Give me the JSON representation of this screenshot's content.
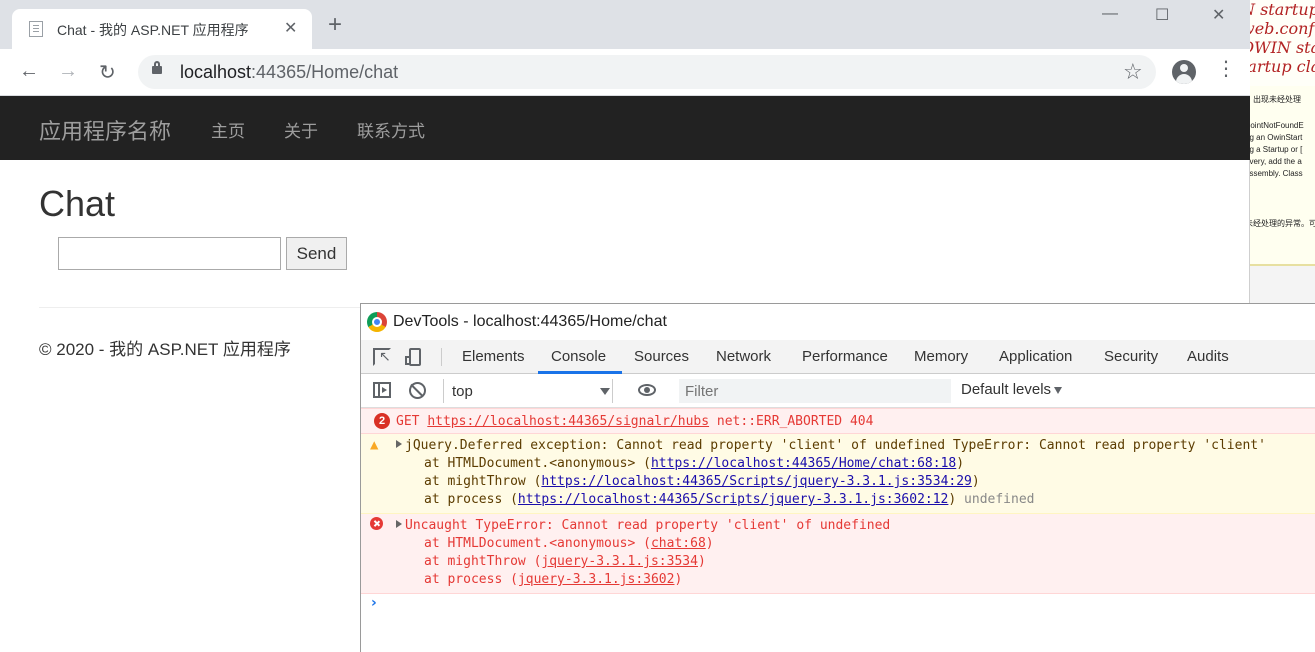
{
  "background_window": {
    "code_lines": [
      "N startup",
      "web.conf",
      "OWIN sta",
      "tartup cla"
    ],
    "panel_lines": [
      "，出现未经处理",
      "PointNotFoundE",
      "ng an OwinStart",
      "ng a Startup or [",
      "overy, add the a",
      "assembly. Class",
      "未经处理的异常。可以"
    ]
  },
  "browser": {
    "tab": {
      "title": "Chat - 我的 ASP.NET 应用程序",
      "close": "✕"
    },
    "new_tab": "+",
    "window_controls": {
      "minimize": "—",
      "maximize": "☐",
      "close": "✕"
    },
    "nav": {
      "back": "←",
      "forward": "→",
      "reload": "↻"
    },
    "url_host": "localhost",
    "url_path": ":44365/Home/chat",
    "bookmark": "☆",
    "menu": "⋮"
  },
  "site": {
    "brand": "应用程序名称",
    "nav_links": [
      "主页",
      "关于",
      "联系方式"
    ],
    "page_title": "Chat",
    "message_input": {
      "value": "",
      "placeholder": ""
    },
    "send_label": "Send",
    "footer": "© 2020 - 我的 ASP.NET 应用程序"
  },
  "devtools": {
    "title": "DevTools - localhost:44365/Home/chat",
    "tabs": [
      "Elements",
      "Console",
      "Sources",
      "Network",
      "Performance",
      "Memory",
      "Application",
      "Security",
      "Audits"
    ],
    "active_tab": "Console",
    "context": "top",
    "filter_placeholder": "Filter",
    "levels": "Default levels",
    "messages": {
      "error_get": {
        "count": "2",
        "method": "GET ",
        "url": "https://localhost:44365/signalr/hubs",
        "status": " net::ERR_ABORTED 404"
      },
      "warning": {
        "text": "jQuery.Deferred exception: Cannot read property 'client' of undefined TypeError: Cannot read property 'client'",
        "stack": [
          {
            "prefix": "at HTMLDocument.<anonymous> (",
            "link": "https://localhost:44365/Home/chat:68:18",
            "suffix": ")"
          },
          {
            "prefix": "at mightThrow (",
            "link": "https://localhost:44365/Scripts/jquery-3.3.1.js:3534:29",
            "suffix": ")"
          },
          {
            "prefix": "at process (",
            "link": "https://localhost:44365/Scripts/jquery-3.3.1.js:3602:12",
            "suffix": ") ",
            "tail": "undefined"
          }
        ]
      },
      "uncaught": {
        "text": "Uncaught TypeError: Cannot read property 'client' of undefined",
        "stack": [
          {
            "prefix": "at HTMLDocument.<anonymous> (",
            "link": "chat:68",
            "suffix": ")"
          },
          {
            "prefix": "at mightThrow (",
            "link": "jquery-3.3.1.js:3534",
            "suffix": ")"
          },
          {
            "prefix": "at process (",
            "link": "jquery-3.3.1.js:3602",
            "suffix": ")"
          }
        ]
      }
    },
    "prompt": "›"
  }
}
